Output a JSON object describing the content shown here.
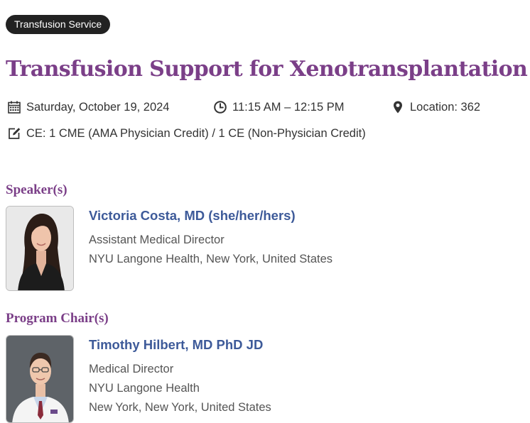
{
  "badge": {
    "label": "Transfusion Service"
  },
  "session": {
    "title": "Transfusion Support for Xenotransplantation",
    "date": "Saturday, October 19, 2024",
    "time": "11:15 AM – 12:15 PM",
    "location": "Location: 362",
    "ce": "CE: 1 CME (AMA Physician Credit) / 1 CE (Non-Physician Credit)"
  },
  "icons": {
    "date": "calendar-icon",
    "time": "clock-icon",
    "location": "map-marker-icon",
    "ce": "edit-icon"
  },
  "speakers": {
    "heading": "Speaker(s)",
    "people": [
      {
        "name": "Victoria Costa, MD (she/her/hers)",
        "lines": [
          "Assistant Medical Director",
          "NYU Langone Health, New York, United States"
        ]
      }
    ]
  },
  "chairs": {
    "heading": "Program Chair(s)",
    "people": [
      {
        "name": "Timothy Hilbert, MD PhD JD",
        "lines": [
          "Medical Director",
          "NYU Langone Health",
          "New York, New York, United States"
        ]
      }
    ]
  },
  "colors": {
    "accent": "#7b3f88",
    "name": "#3d5a99",
    "badge_bg": "#222222"
  }
}
